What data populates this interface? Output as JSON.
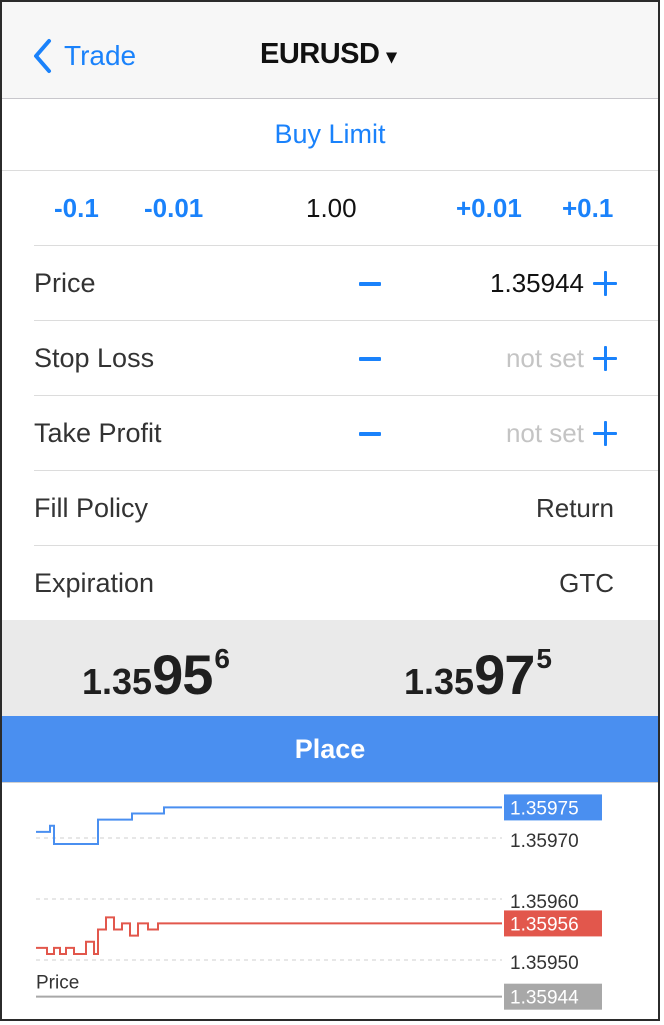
{
  "nav": {
    "back_label": "Trade",
    "symbol": "EURUSD",
    "symbol_caret": "▾",
    "back_icon": "chevron-left-icon"
  },
  "order_type": "Buy Limit",
  "volume": {
    "dec_large": "-0.1",
    "dec_small": "-0.01",
    "value": "1.00",
    "inc_small": "+0.01",
    "inc_large": "+0.1"
  },
  "fields": {
    "price": {
      "label": "Price",
      "value": "1.35944"
    },
    "stop_loss": {
      "label": "Stop Loss",
      "value": "not set"
    },
    "take_profit": {
      "label": "Take Profit",
      "value": "not set"
    },
    "fill_policy": {
      "label": "Fill Policy",
      "value": "Return"
    },
    "expiration": {
      "label": "Expiration",
      "value": "GTC"
    }
  },
  "quotes": {
    "bid": {
      "prefix": "1.35",
      "big": "95",
      "sup": "6"
    },
    "ask": {
      "prefix": "1.35",
      "big": "97",
      "sup": "5"
    }
  },
  "place_label": "Place",
  "colors": {
    "accent": "#1a82fb",
    "place_button": "#4a8ff0",
    "ask_line": "#4a8ff0",
    "bid_line": "#e2574c",
    "price_line": "#a8a8a8"
  },
  "chart_data": {
    "type": "line",
    "ylim": [
      1.35941,
      1.35979
    ],
    "gridlines": [
      1.3597,
      1.3596,
      1.3595
    ],
    "price_label": "Price",
    "labels": {
      "ask": "1.35975",
      "g1": "1.35970",
      "g2": "1.35960",
      "bid": "1.35956",
      "g3": "1.35950",
      "price": "1.35944"
    },
    "price_level": 1.35944,
    "series": [
      {
        "key": "ask",
        "values": [
          1.35971,
          1.35971,
          1.35972,
          1.35972,
          1.35969,
          1.35969,
          1.35969,
          1.35969,
          1.35973,
          1.35973,
          1.35974,
          1.35974,
          1.35975,
          1.35975,
          1.35975
        ]
      },
      {
        "key": "bid",
        "values": [
          1.35952,
          1.35951,
          1.35952,
          1.35951,
          1.35952,
          1.35951,
          1.35953,
          1.35951,
          1.35955,
          1.35957,
          1.35955,
          1.35956,
          1.35954,
          1.35956,
          1.35955,
          1.35956,
          1.35956
        ]
      }
    ]
  }
}
